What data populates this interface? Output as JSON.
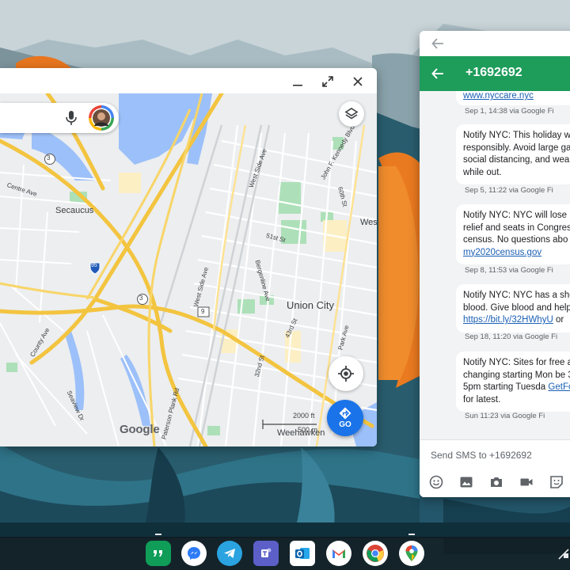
{
  "maps": {
    "places": {
      "secaucus": "Secaucus",
      "union_city": "Union City",
      "weehawken": "Weehawken",
      "west": "Wes"
    },
    "streets": [
      "Centre Ave",
      "County Ave",
      "Seaview Dr",
      "Paterson Plank Rd",
      "West Side Ave",
      "West Side Ave",
      "Bergenline Ave",
      "51st St",
      "60th St",
      "43rd St",
      "32nd St",
      "Park Ave",
      "John F. Kennedy Blvd"
    ],
    "route_shields": [
      "3",
      "95",
      "3",
      "9"
    ],
    "scale_feet": "2000 ft",
    "scale_meters": "500 m",
    "go_label": "GO",
    "logo_text": "Google"
  },
  "messages": {
    "contact": "+1692692",
    "thread": [
      {
        "text": "",
        "link": "www.nyccare.nyc",
        "meta": "Sep 1, 14:38 via Google Fi"
      },
      {
        "text": "Notify NYC: This holiday w responsibly. Avoid large ga social distancing, and wea while out.",
        "link": "",
        "meta": "Sep 5, 11:22 via Google Fi"
      },
      {
        "text": "Notify NYC: NYC will lose l relief and seats in Congres census. No questions abo",
        "link": "my2020census.gov",
        "meta": "Sep 8, 11:53 via Google Fi"
      },
      {
        "text": "Notify NYC: NYC has a sho blood. Give blood and help",
        "link": "https://bit.ly/32HWhyU",
        "tail": " or",
        "meta": "Sep 18, 11:20 via Google Fi"
      },
      {
        "text": "Notify NYC: Sites for free are changing starting Mon be 3-5pm starting Tuesda",
        "link": "GetFood",
        "tail": " for latest.",
        "meta": "Sun 11:23 via Google Fi"
      }
    ],
    "compose_placeholder": "Send SMS to +1692692"
  },
  "shelf": {
    "apps": [
      "Hangouts",
      "Messenger",
      "Telegram",
      "Teams",
      "Outlook",
      "Gmail",
      "Chrome",
      "Maps"
    ]
  },
  "colors": {
    "messages_accent": "#1e9c5a",
    "link": "#1a5fb4",
    "maps_go": "#1a73e8",
    "highway": "#f5c542"
  }
}
